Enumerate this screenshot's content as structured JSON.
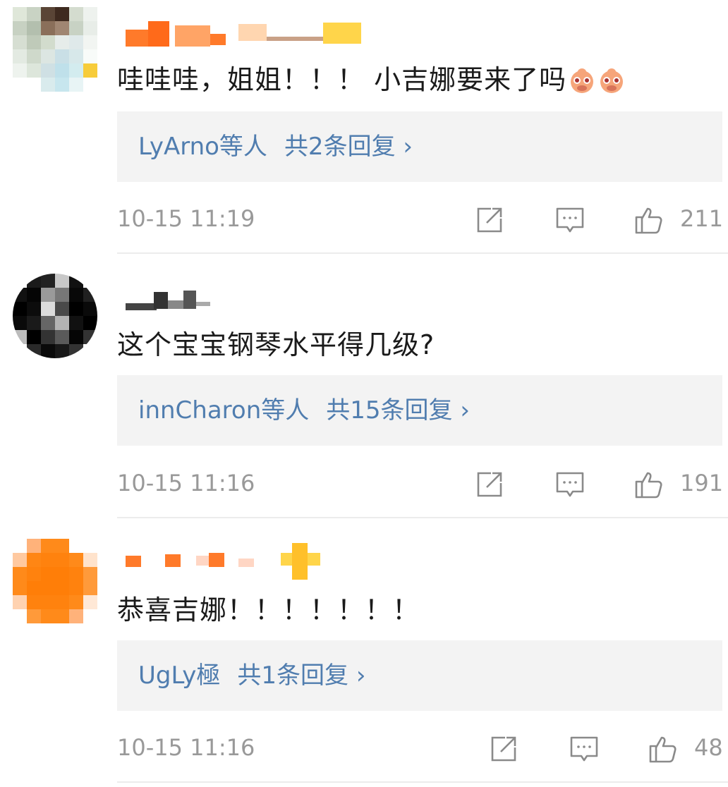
{
  "comments": [
    {
      "text": "哇哇哇，姐姐！！！ 小吉娜要来了吗",
      "emoji": [
        "doge-emoji",
        "doge-emoji"
      ],
      "reply_users": "LyArno等人",
      "reply_count": "共2条回复 ›",
      "time": "10-15 11:19",
      "likes": "211"
    },
    {
      "text": "这个宝宝钢琴水平得几级?",
      "reply_users": "innCharon等人",
      "reply_count": "共15条回复 ›",
      "time": "10-15 11:16",
      "likes": "191"
    },
    {
      "text": "恭喜吉娜！！！！！！！",
      "reply_users": "UgLy極",
      "reply_count": "共1条回复 ›",
      "time": "10-15 11:16",
      "likes": "48"
    }
  ],
  "colors": {
    "link": "#507daf",
    "meta": "#999999",
    "reply_bg": "#f3f3f3"
  },
  "icons": {
    "share": "share-icon",
    "comment": "comment-icon",
    "like": "thumbs-up-icon"
  }
}
